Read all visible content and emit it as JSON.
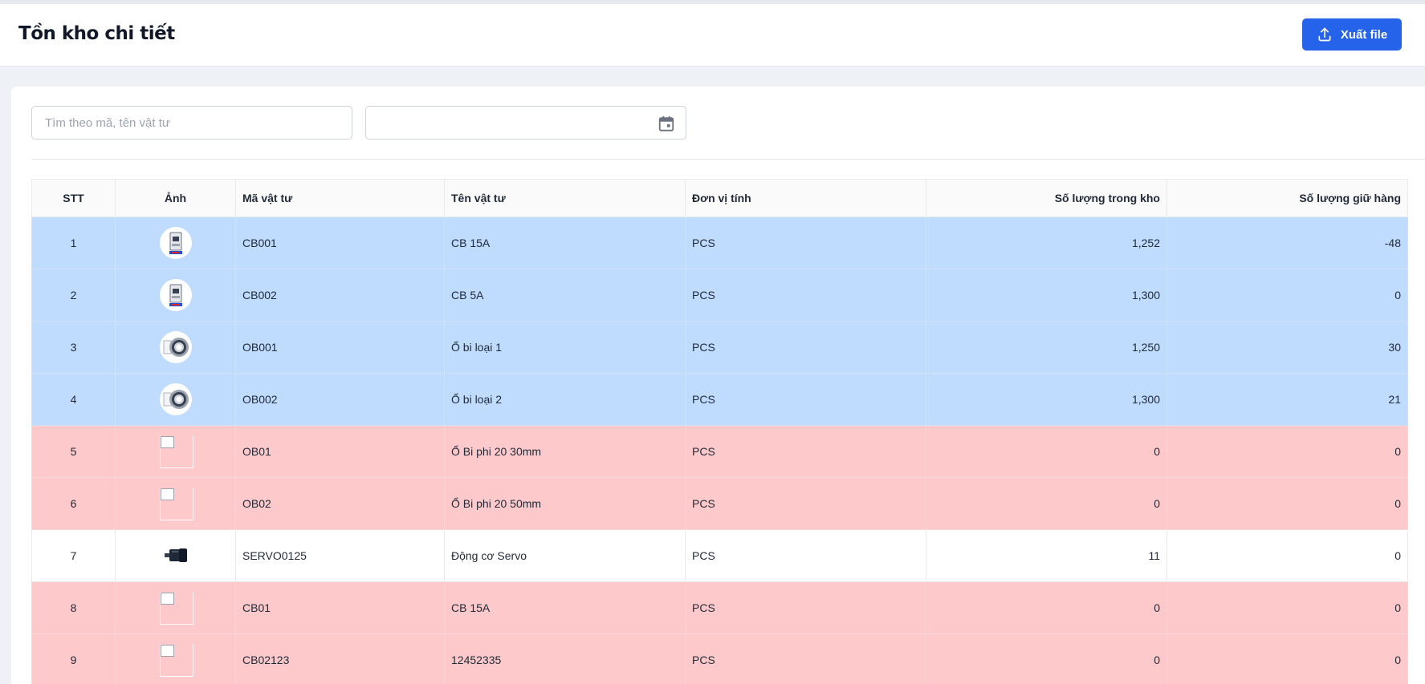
{
  "page": {
    "title": "Tồn kho chi tiết"
  },
  "toolbar": {
    "export_label": "Xuất file",
    "export_icon": "upload-icon"
  },
  "filters": {
    "search_placeholder": "Tìm theo mã, tên vật tư",
    "search_value": "",
    "date_value": "",
    "date_icon": "calendar-icon"
  },
  "table": {
    "headers": {
      "stt": "STT",
      "image": "Ảnh",
      "code": "Mã vật tư",
      "name": "Tên vật tư",
      "unit": "Đơn vị tính",
      "stock": "Số lượng trong kho",
      "hold": "Số lượng giữ hàng"
    },
    "rows": [
      {
        "stt": "1",
        "image": "circuit-breaker",
        "code": "CB001",
        "name": "CB 15A",
        "unit": "PCS",
        "stock": "1,252",
        "hold": "-48",
        "status": "blue"
      },
      {
        "stt": "2",
        "image": "circuit-breaker",
        "code": "CB002",
        "name": "CB 5A",
        "unit": "PCS",
        "stock": "1,300",
        "hold": "0",
        "status": "blue"
      },
      {
        "stt": "3",
        "image": "ball-bearing",
        "code": "OB001",
        "name": "Ổ bi loại 1",
        "unit": "PCS",
        "stock": "1,250",
        "hold": "30",
        "status": "blue"
      },
      {
        "stt": "4",
        "image": "ball-bearing",
        "code": "OB002",
        "name": "Ổ bi loại 2",
        "unit": "PCS",
        "stock": "1,300",
        "hold": "21",
        "status": "blue"
      },
      {
        "stt": "5",
        "image": "broken-image",
        "code": "OB01",
        "name": "Ổ Bi phi 20 30mm",
        "unit": "PCS",
        "stock": "0",
        "hold": "0",
        "status": "red"
      },
      {
        "stt": "6",
        "image": "broken-image",
        "code": "OB02",
        "name": "Ổ Bi phi 20 50mm",
        "unit": "PCS",
        "stock": "0",
        "hold": "0",
        "status": "red"
      },
      {
        "stt": "7",
        "image": "servo-motor",
        "code": "SERVO0125",
        "name": "Động cơ Servo",
        "unit": "PCS",
        "stock": "11",
        "hold": "0",
        "status": "white"
      },
      {
        "stt": "8",
        "image": "broken-image",
        "code": "CB01",
        "name": "CB 15A",
        "unit": "PCS",
        "stock": "0",
        "hold": "0",
        "status": "red"
      },
      {
        "stt": "9",
        "image": "broken-image",
        "code": "CB02123",
        "name": "12452335",
        "unit": "PCS",
        "stock": "0",
        "hold": "0",
        "status": "red"
      }
    ]
  },
  "colors": {
    "primary": "#2563eb",
    "row_blue": "#bfdbfe",
    "row_red": "#fdc9cb",
    "row_white": "#ffffff"
  }
}
